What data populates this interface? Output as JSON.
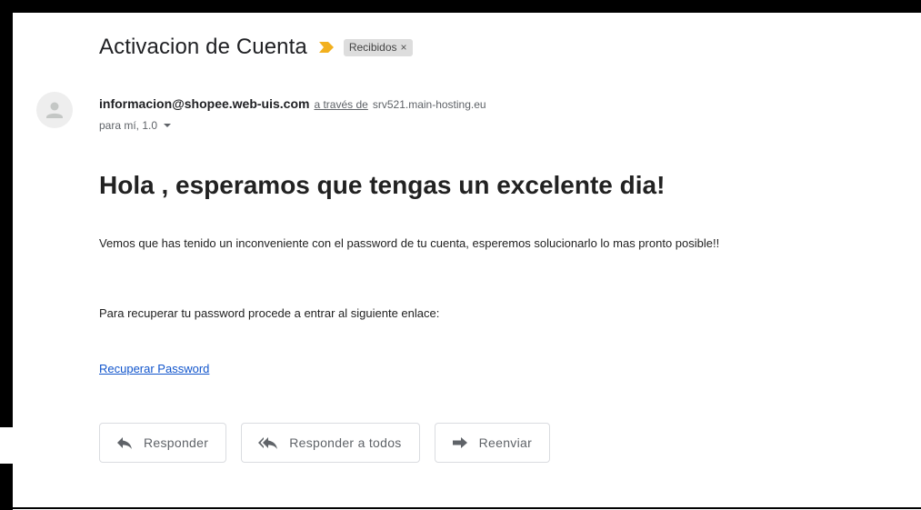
{
  "email": {
    "subject": "Activacion de Cuenta",
    "label": "Recibidos",
    "label_close": "×",
    "sender": {
      "email": "informacion@shopee.web-uis.com",
      "via_text": "a través de",
      "via_domain": "srv521.main-hosting.eu"
    },
    "recipient_line": "para mí, 1.0",
    "body": {
      "greeting": "Hola , esperamos que tengas un excelente dia!",
      "paragraph_1": "Vemos que has tenido un inconveniente con el password de tu cuenta, esperemos solucionarlo lo mas pronto posible!!",
      "paragraph_2": "Para recuperar tu password procede a entrar al siguiente enlace:",
      "link_text": "Recuperar Password"
    }
  },
  "actions": {
    "reply": "Responder",
    "reply_all": "Responder a todos",
    "forward": "Reenviar"
  },
  "icons": {
    "importance": "importance-marker-icon",
    "avatar": "default-avatar-icon",
    "reply": "reply-icon",
    "reply_all": "reply-all-icon",
    "forward": "forward-icon"
  },
  "colors": {
    "importance": "#f2b01e",
    "link": "#1155cc",
    "label_bg": "#dddddd",
    "button_border": "#dadce0"
  }
}
